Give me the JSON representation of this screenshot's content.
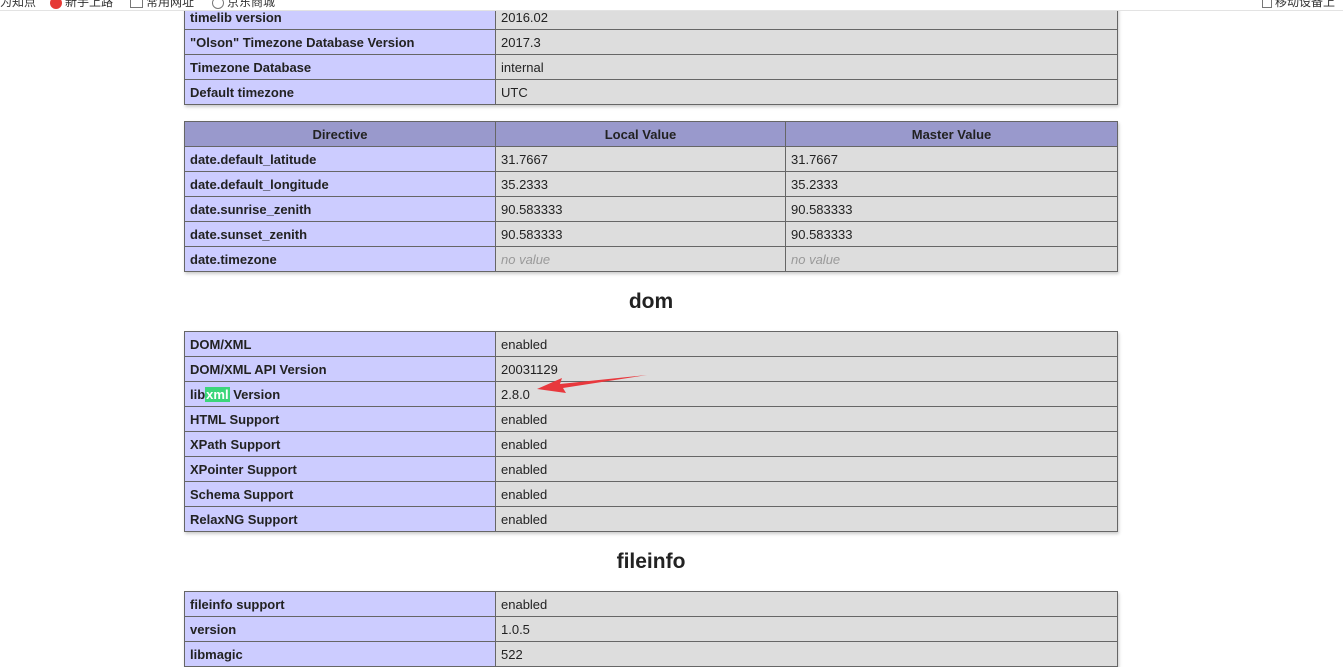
{
  "bookmarks": [
    {
      "label": "为知点",
      "icon": "bookmark-icon"
    },
    {
      "label": "新手上路",
      "icon": "app-icon"
    },
    {
      "label": "常用网址",
      "icon": "folder-icon"
    },
    {
      "label": "京东商城",
      "icon": "globe-icon"
    },
    {
      "label": "移动设备上",
      "icon": "mobile-icon"
    }
  ],
  "date": {
    "info_rows": [
      {
        "name": "timelib version",
        "value": "2016.02"
      },
      {
        "name": "\"Olson\" Timezone Database Version",
        "value": "2017.3"
      },
      {
        "name": "Timezone Database",
        "value": "internal"
      },
      {
        "name": "Default timezone",
        "value": "UTC"
      }
    ],
    "directive_headers": [
      "Directive",
      "Local Value",
      "Master Value"
    ],
    "directives": [
      {
        "name": "date.default_latitude",
        "local": "31.7667",
        "master": "31.7667"
      },
      {
        "name": "date.default_longitude",
        "local": "35.2333",
        "master": "35.2333"
      },
      {
        "name": "date.sunrise_zenith",
        "local": "90.583333",
        "master": "90.583333"
      },
      {
        "name": "date.sunset_zenith",
        "local": "90.583333",
        "master": "90.583333"
      },
      {
        "name": "date.timezone",
        "local": "no value",
        "master": "no value"
      }
    ]
  },
  "dom": {
    "title": "dom",
    "rows": [
      {
        "name": "DOM/XML",
        "value": "enabled"
      },
      {
        "name": "DOM/XML API Version",
        "value": "20031129"
      },
      {
        "name_prefix": "lib",
        "name_highlight": "xml",
        "name_suffix": " Version",
        "value": "2.8.0"
      },
      {
        "name": "HTML Support",
        "value": "enabled"
      },
      {
        "name": "XPath Support",
        "value": "enabled"
      },
      {
        "name": "XPointer Support",
        "value": "enabled"
      },
      {
        "name": "Schema Support",
        "value": "enabled"
      },
      {
        "name": "RelaxNG Support",
        "value": "enabled"
      }
    ]
  },
  "fileinfo": {
    "title": "fileinfo",
    "rows": [
      {
        "name": "fileinfo support",
        "value": "enabled"
      },
      {
        "name": "version",
        "value": "1.0.5"
      },
      {
        "name": "libmagic",
        "value": "522"
      }
    ]
  },
  "colors": {
    "row_label_bg": "#ccccff",
    "row_value_bg": "#dddddd",
    "header_bg": "#9999cc",
    "search_highlight": "#3bd67a",
    "annotation_arrow": "#e8383d"
  }
}
